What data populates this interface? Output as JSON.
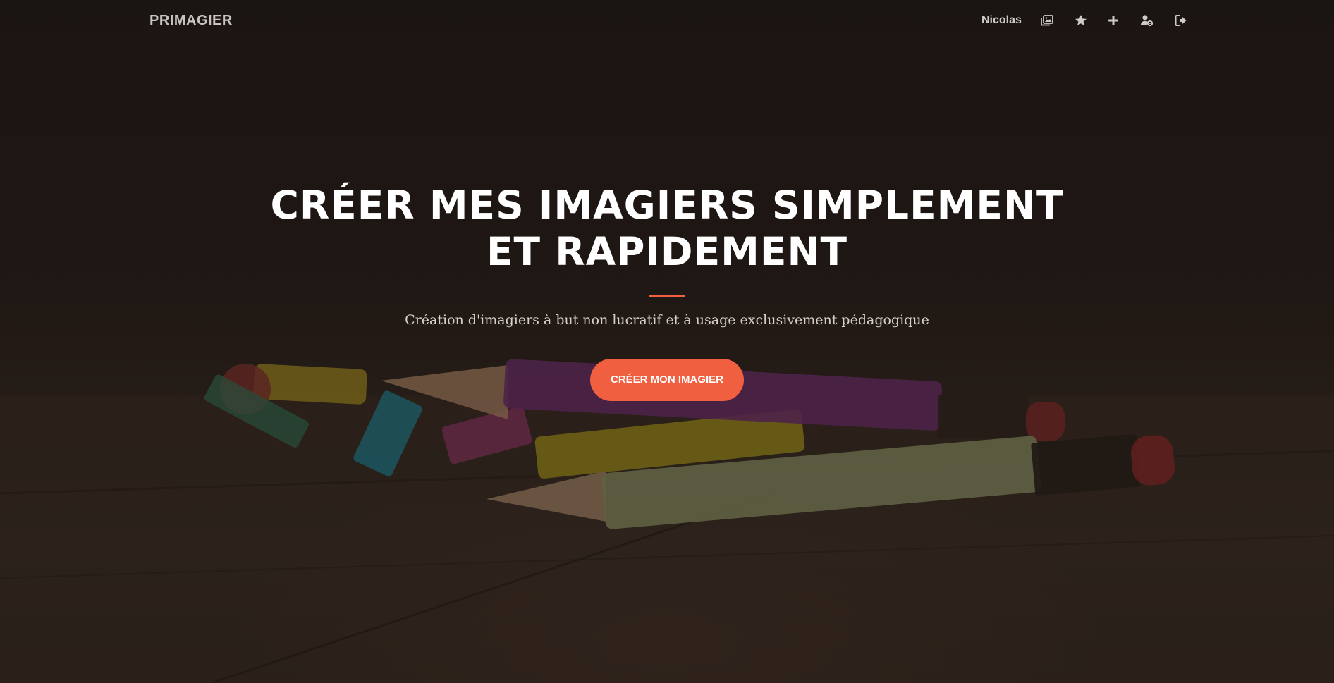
{
  "navbar": {
    "brand": "PRIMAGIER",
    "user_name": "Nicolas",
    "icons": [
      "images-icon",
      "star-icon",
      "plus-icon",
      "user-gear-icon",
      "sign-out-icon"
    ]
  },
  "hero": {
    "headline": "CRÉER MES IMAGIERS SIMPLEMENT ET RAPIDEMENT",
    "subtitle": "Création d'imagiers à but non lucratif et à usage exclusivement pédagogique",
    "cta_label": "CRÉER MON IMAGIER"
  },
  "colors": {
    "accent": "#f05f40",
    "headline": "#ffffff",
    "nav_text": "#cfcac7"
  }
}
